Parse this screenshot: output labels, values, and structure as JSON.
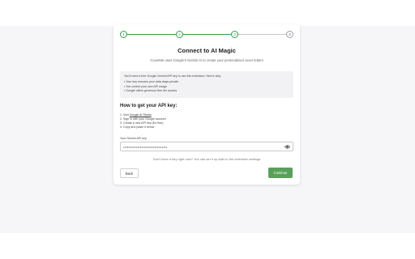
{
  "stepper": {
    "steps": [
      "1",
      "2",
      "3",
      "4"
    ],
    "completed_color": "#3a9a48",
    "pending_color": "#c8c8cc"
  },
  "header": {
    "title": "Connect to AI Magic",
    "subtitle": "CoverMe uses Google's Gemini AI to create your personalized cover letters"
  },
  "info": {
    "intro": "You'll need a free Google Gemini API key to use this extension. Here's why:",
    "items": [
      "Your key ensures your data stays private",
      "You control your own API usage",
      "Google offers generous free tier access"
    ]
  },
  "howto": {
    "title": "How to get your API key:",
    "step1_prefix": "1. Visit ",
    "step1_link": "Google AI Studio",
    "steps": [
      "2. Sign in with your Google account",
      "3. Create a new API key (it's free)",
      "4. Copy and paste it below"
    ]
  },
  "api_key": {
    "label": "Your Gemini API key",
    "value": "••••••••••••••••••••••••••••••••••"
  },
  "note": "Don't have a key right now? You can set it up later in the extension settings",
  "buttons": {
    "back": "Back",
    "continue": "Continue"
  },
  "colors": {
    "accent": "#5aa05a",
    "background": "#f6f6f8"
  }
}
